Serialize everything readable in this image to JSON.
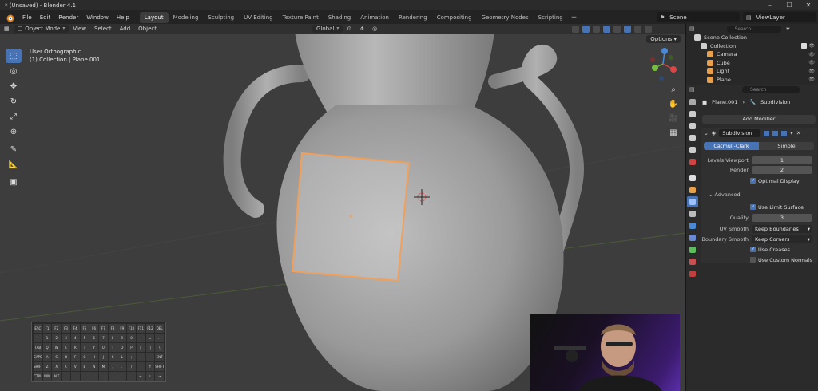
{
  "window": {
    "title": "* (Unsaved) - Blender 4.1"
  },
  "menu": [
    "File",
    "Edit",
    "Render",
    "Window",
    "Help"
  ],
  "workspaces": [
    "Layout",
    "Modeling",
    "Sculpting",
    "UV Editing",
    "Texture Paint",
    "Shading",
    "Animation",
    "Rendering",
    "Compositing",
    "Geometry Nodes",
    "Scripting"
  ],
  "active_workspace": "Layout",
  "scene": "Scene",
  "view_layer": "ViewLayer",
  "viewport_header": {
    "mode": "Object Mode",
    "items": [
      "View",
      "Select",
      "Add",
      "Object"
    ],
    "transform": "Global",
    "options": "Options"
  },
  "viewport_info": {
    "line1": "User Orthographic",
    "line2": "(1) Collection | Plane.001"
  },
  "outliner": {
    "search_placeholder": "Search",
    "rows": [
      {
        "label": "Scene Collection",
        "icon_color": "#cfcfcf"
      },
      {
        "label": "Collection",
        "icon_color": "#cfcfcf"
      },
      {
        "label": "Camera",
        "icon_color": "#e8a04b"
      },
      {
        "label": "Cube",
        "icon_color": "#e8a04b"
      },
      {
        "label": "Light",
        "icon_color": "#e8a04b"
      },
      {
        "label": "Plane",
        "icon_color": "#e8a04b"
      }
    ]
  },
  "properties": {
    "search_placeholder": "Search",
    "breadcrumb": [
      "Plane.001",
      "Subdivision"
    ],
    "add_modifier": "Add Modifier",
    "modifier": {
      "name": "Subdivision",
      "types": [
        "Catmull-Clark",
        "Simple"
      ],
      "active_type": "Catmull-Clark",
      "levels_viewport_label": "Levels Viewport",
      "levels_viewport": "1",
      "render_label": "Render",
      "render": "2",
      "optimal_display": "Optimal Display",
      "advanced": "Advanced",
      "use_limit_surface": "Use Limit Surface",
      "quality_label": "Quality",
      "quality": "3",
      "uv_smooth_label": "UV Smooth",
      "uv_smooth": "Keep Boundaries",
      "boundary_smooth_label": "Boundary Smooth",
      "boundary_smooth": "Keep Corners",
      "use_creases": "Use Creases",
      "use_custom_normals": "Use Custom Normals"
    }
  },
  "keyboard": {
    "rows": [
      [
        "ESC",
        "F1",
        "F2",
        "F3",
        "F4",
        "F5",
        "F6",
        "F7",
        "F8",
        "F9",
        "F10",
        "F11",
        "F12",
        "DEL"
      ],
      [
        "`",
        "1",
        "2",
        "3",
        "4",
        "5",
        "6",
        "7",
        "8",
        "9",
        "0",
        "-",
        "=",
        "←"
      ],
      [
        "TAB",
        "Q",
        "W",
        "E",
        "R",
        "T",
        "Y",
        "U",
        "I",
        "O",
        "P",
        "[",
        "]",
        "\\"
      ],
      [
        "CAPS",
        "A",
        "S",
        "D",
        "F",
        "G",
        "H",
        "J",
        "K",
        "L",
        ";",
        "'",
        "",
        "ENT"
      ],
      [
        "SHIFT",
        "Z",
        "X",
        "C",
        "V",
        "B",
        "N",
        "M",
        ",",
        ".",
        "/",
        "",
        "↑",
        "SHIFT"
      ],
      [
        "CTRL",
        "WIN",
        "ALT",
        "",
        "",
        "",
        "",
        "",
        "",
        "",
        "",
        "←",
        "↓",
        "→"
      ]
    ]
  },
  "colors": {
    "accent": "#4772b3",
    "selection": "#f0a05a",
    "viewport_bg": "#3d3d3d"
  }
}
